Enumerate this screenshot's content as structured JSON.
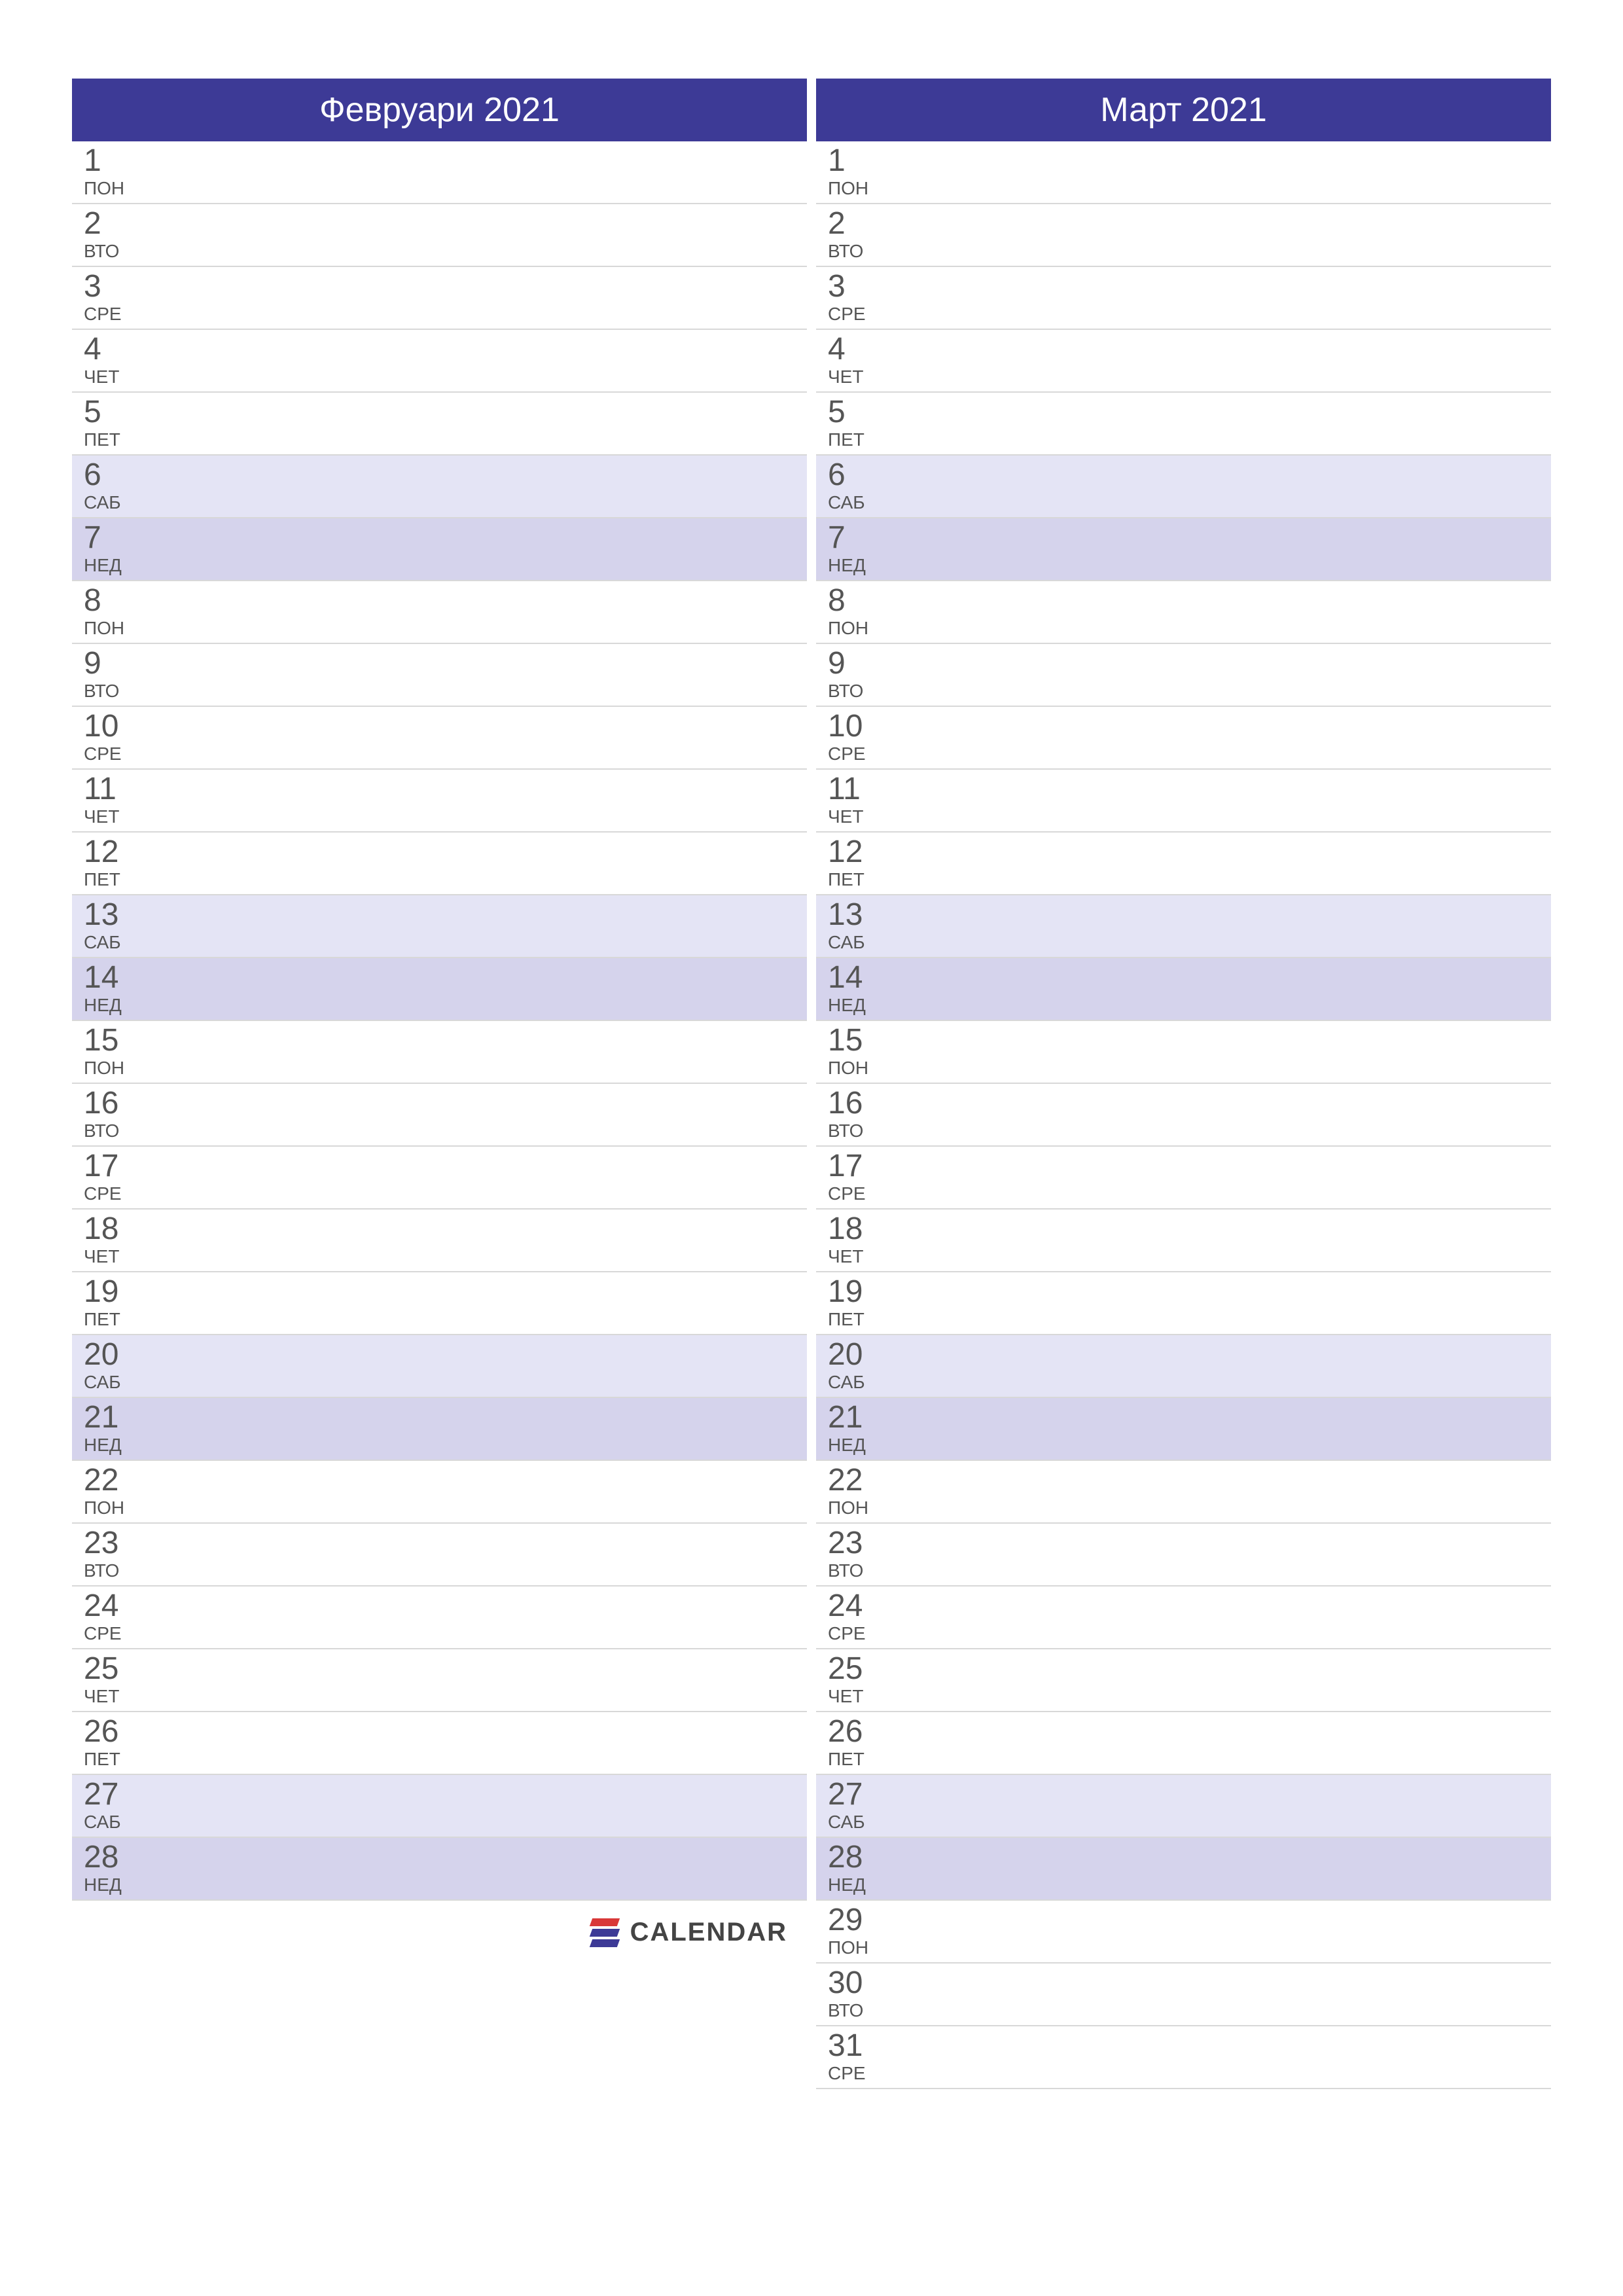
{
  "logo_text": "CALENDAR",
  "weekdays": [
    "ПОН",
    "ВТО",
    "СРЕ",
    "ЧЕТ",
    "ПЕТ",
    "САБ",
    "НЕД"
  ],
  "colors": {
    "header_bg": "#3d3a96",
    "sat_bg": "#e4e4f5",
    "sun_bg": "#d5d3ec"
  },
  "months": [
    {
      "title": "Февруари 2021",
      "days": [
        {
          "n": "1",
          "w": "ПОН",
          "t": "wd"
        },
        {
          "n": "2",
          "w": "ВТО",
          "t": "wd"
        },
        {
          "n": "3",
          "w": "СРЕ",
          "t": "wd"
        },
        {
          "n": "4",
          "w": "ЧЕТ",
          "t": "wd"
        },
        {
          "n": "5",
          "w": "ПЕТ",
          "t": "wd"
        },
        {
          "n": "6",
          "w": "САБ",
          "t": "sat"
        },
        {
          "n": "7",
          "w": "НЕД",
          "t": "sun"
        },
        {
          "n": "8",
          "w": "ПОН",
          "t": "wd"
        },
        {
          "n": "9",
          "w": "ВТО",
          "t": "wd"
        },
        {
          "n": "10",
          "w": "СРЕ",
          "t": "wd"
        },
        {
          "n": "11",
          "w": "ЧЕТ",
          "t": "wd"
        },
        {
          "n": "12",
          "w": "ПЕТ",
          "t": "wd"
        },
        {
          "n": "13",
          "w": "САБ",
          "t": "sat"
        },
        {
          "n": "14",
          "w": "НЕД",
          "t": "sun"
        },
        {
          "n": "15",
          "w": "ПОН",
          "t": "wd"
        },
        {
          "n": "16",
          "w": "ВТО",
          "t": "wd"
        },
        {
          "n": "17",
          "w": "СРЕ",
          "t": "wd"
        },
        {
          "n": "18",
          "w": "ЧЕТ",
          "t": "wd"
        },
        {
          "n": "19",
          "w": "ПЕТ",
          "t": "wd"
        },
        {
          "n": "20",
          "w": "САБ",
          "t": "sat"
        },
        {
          "n": "21",
          "w": "НЕД",
          "t": "sun"
        },
        {
          "n": "22",
          "w": "ПОН",
          "t": "wd"
        },
        {
          "n": "23",
          "w": "ВТО",
          "t": "wd"
        },
        {
          "n": "24",
          "w": "СРЕ",
          "t": "wd"
        },
        {
          "n": "25",
          "w": "ЧЕТ",
          "t": "wd"
        },
        {
          "n": "26",
          "w": "ПЕТ",
          "t": "wd"
        },
        {
          "n": "27",
          "w": "САБ",
          "t": "sat"
        },
        {
          "n": "28",
          "w": "НЕД",
          "t": "sun"
        }
      ],
      "has_logo_after": true
    },
    {
      "title": "Март 2021",
      "days": [
        {
          "n": "1",
          "w": "ПОН",
          "t": "wd"
        },
        {
          "n": "2",
          "w": "ВТО",
          "t": "wd"
        },
        {
          "n": "3",
          "w": "СРЕ",
          "t": "wd"
        },
        {
          "n": "4",
          "w": "ЧЕТ",
          "t": "wd"
        },
        {
          "n": "5",
          "w": "ПЕТ",
          "t": "wd"
        },
        {
          "n": "6",
          "w": "САБ",
          "t": "sat"
        },
        {
          "n": "7",
          "w": "НЕД",
          "t": "sun"
        },
        {
          "n": "8",
          "w": "ПОН",
          "t": "wd"
        },
        {
          "n": "9",
          "w": "ВТО",
          "t": "wd"
        },
        {
          "n": "10",
          "w": "СРЕ",
          "t": "wd"
        },
        {
          "n": "11",
          "w": "ЧЕТ",
          "t": "wd"
        },
        {
          "n": "12",
          "w": "ПЕТ",
          "t": "wd"
        },
        {
          "n": "13",
          "w": "САБ",
          "t": "sat"
        },
        {
          "n": "14",
          "w": "НЕД",
          "t": "sun"
        },
        {
          "n": "15",
          "w": "ПОН",
          "t": "wd"
        },
        {
          "n": "16",
          "w": "ВТО",
          "t": "wd"
        },
        {
          "n": "17",
          "w": "СРЕ",
          "t": "wd"
        },
        {
          "n": "18",
          "w": "ЧЕТ",
          "t": "wd"
        },
        {
          "n": "19",
          "w": "ПЕТ",
          "t": "wd"
        },
        {
          "n": "20",
          "w": "САБ",
          "t": "sat"
        },
        {
          "n": "21",
          "w": "НЕД",
          "t": "sun"
        },
        {
          "n": "22",
          "w": "ПОН",
          "t": "wd"
        },
        {
          "n": "23",
          "w": "ВТО",
          "t": "wd"
        },
        {
          "n": "24",
          "w": "СРЕ",
          "t": "wd"
        },
        {
          "n": "25",
          "w": "ЧЕТ",
          "t": "wd"
        },
        {
          "n": "26",
          "w": "ПЕТ",
          "t": "wd"
        },
        {
          "n": "27",
          "w": "САБ",
          "t": "sat"
        },
        {
          "n": "28",
          "w": "НЕД",
          "t": "sun"
        },
        {
          "n": "29",
          "w": "ПОН",
          "t": "wd"
        },
        {
          "n": "30",
          "w": "ВТО",
          "t": "wd"
        },
        {
          "n": "31",
          "w": "СРЕ",
          "t": "wd"
        }
      ],
      "has_logo_after": false
    }
  ]
}
